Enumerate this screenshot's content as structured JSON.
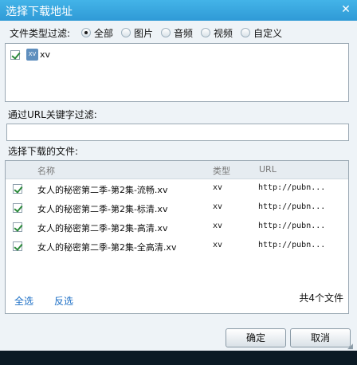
{
  "window": {
    "title": "选择下载地址",
    "close_icon": "close-icon"
  },
  "file_type_filter": {
    "label": "文件类型过滤:",
    "options": [
      {
        "label": "全部",
        "checked": true
      },
      {
        "label": "图片",
        "checked": false
      },
      {
        "label": "音频",
        "checked": false
      },
      {
        "label": "视频",
        "checked": false
      },
      {
        "label": "自定义",
        "checked": false
      }
    ],
    "types": [
      {
        "ext": "xv",
        "checked": true,
        "icon": "xv-file-icon",
        "icon_text": "XV"
      }
    ]
  },
  "url_filter": {
    "label": "通过URL关键字过滤:",
    "value": ""
  },
  "files": {
    "label": "选择下载的文件:",
    "columns": {
      "name": "名称",
      "type": "类型",
      "url": "URL"
    },
    "rows": [
      {
        "name": "女人的秘密第二季-第2集-流畅.xv",
        "type": "xv",
        "url": "http://pubn...",
        "checked": true
      },
      {
        "name": "女人的秘密第二季-第2集-标清.xv",
        "type": "xv",
        "url": "http://pubn...",
        "checked": true
      },
      {
        "name": "女人的秘密第二季-第2集-高清.xv",
        "type": "xv",
        "url": "http://pubn...",
        "checked": true
      },
      {
        "name": "女人的秘密第二季-第2集-全高清.xv",
        "type": "xv",
        "url": "http://pubn...",
        "checked": true
      }
    ],
    "select_all": "全选",
    "invert": "反选",
    "count": "共4个文件"
  },
  "buttons": {
    "ok": "确定",
    "cancel": "取消"
  },
  "colors": {
    "titlebar": "#3aa8e2",
    "link": "#1c6fc6",
    "check": "#2c8a3b"
  }
}
